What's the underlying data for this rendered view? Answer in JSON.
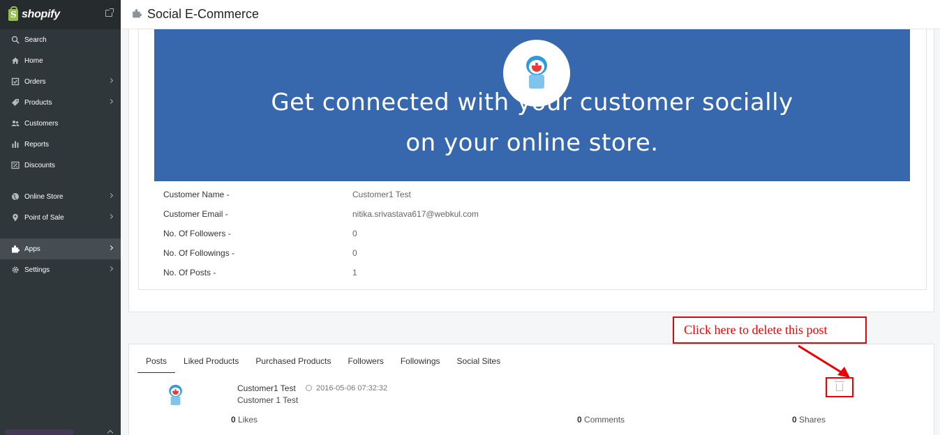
{
  "brand": {
    "name": "shopify"
  },
  "sidebar": {
    "items": [
      {
        "label": "Search",
        "icon": "search-icon"
      },
      {
        "label": "Home",
        "icon": "home-icon"
      },
      {
        "label": "Orders",
        "icon": "orders-icon"
      },
      {
        "label": "Products",
        "icon": "tag-icon"
      },
      {
        "label": "Customers",
        "icon": "customers-icon"
      },
      {
        "label": "Reports",
        "icon": "reports-icon"
      },
      {
        "label": "Discounts",
        "icon": "discounts-icon"
      },
      {
        "label": "Online Store",
        "icon": "globe-icon"
      },
      {
        "label": "Point of Sale",
        "icon": "location-pin-icon"
      },
      {
        "label": "Apps",
        "icon": "puzzle-icon"
      },
      {
        "label": "Settings",
        "icon": "gear-icon"
      }
    ]
  },
  "header": {
    "title": "Social E-Commerce"
  },
  "banner": {
    "line1": "Get connected with your customer socially",
    "line2": "on your online store."
  },
  "profile": {
    "rows": [
      {
        "label": "Customer Name -",
        "value": "Customer1 Test"
      },
      {
        "label": "Customer Email -",
        "value": "nitika.srivastava617@webkul.com"
      },
      {
        "label": "No. Of Followers -",
        "value": "0"
      },
      {
        "label": "No. Of Followings -",
        "value": "0"
      },
      {
        "label": "No. Of Posts -",
        "value": "1"
      }
    ]
  },
  "tabs": [
    "Posts",
    "Liked Products",
    "Purchased Products",
    "Followers",
    "Followings",
    "Social Sites"
  ],
  "post": {
    "author": "Customer1 Test",
    "timestamp": "2016-05-06 07:32:32",
    "body": "Customer 1 Test",
    "likes_count": "0",
    "likes_label": " Likes",
    "comments_count": "0",
    "comments_label": " Comments",
    "shares_count": "0",
    "shares_label": " Shares"
  },
  "annotation": {
    "text": "Click here to delete this post"
  },
  "colors": {
    "accent": "#e00000",
    "banner": "#3768ad",
    "sidebar": "#30373b"
  }
}
